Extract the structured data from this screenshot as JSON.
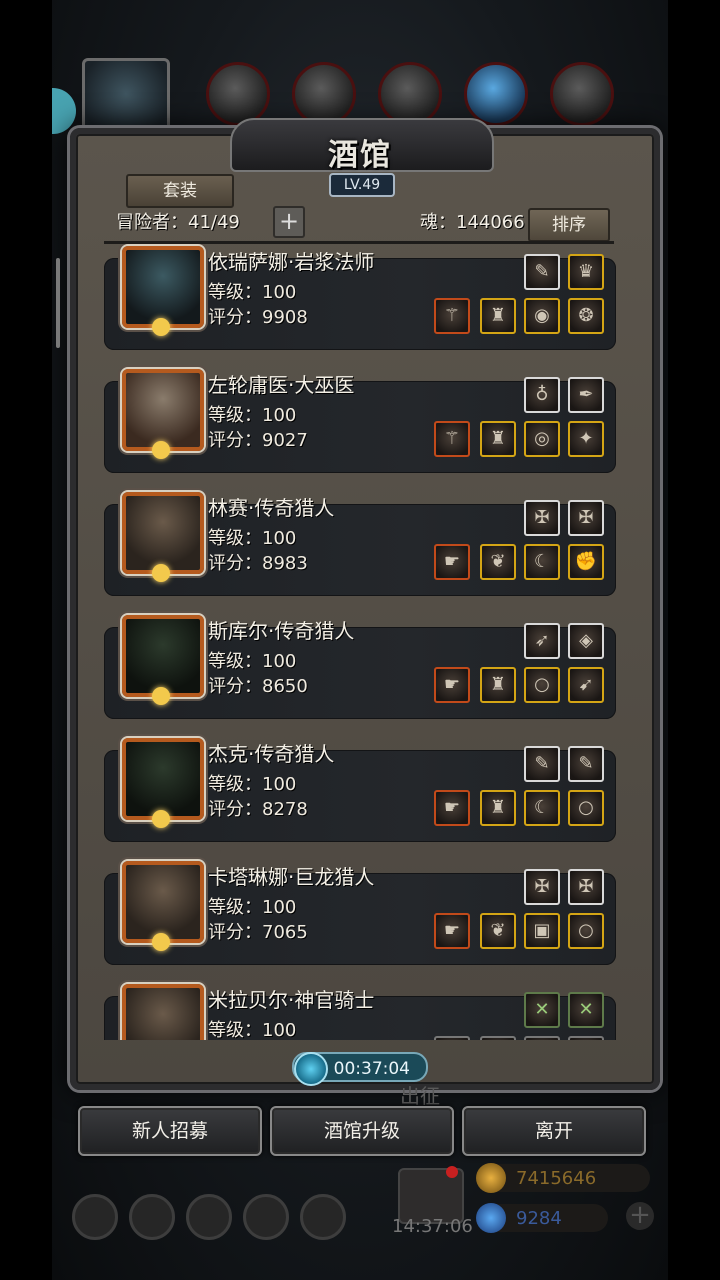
{
  "panel": {
    "title": "酒馆",
    "level_badge": "LV.49",
    "set_tab": "套装",
    "adventurers": "冒险者：41/49",
    "soul": "魂：144066",
    "sort_button": "排序",
    "plus_symbol": "+"
  },
  "heroes": [
    {
      "name": "依瑞萨娜·岩浆法师",
      "level": "等级：100",
      "score": "评分：9908",
      "portrait": "teal",
      "slots_top": [
        {
          "frame": "white",
          "icon": "feather-icon",
          "glyph": "✎"
        },
        {
          "frame": "gold",
          "icon": "trophy-icon",
          "glyph": "♛"
        }
      ],
      "slots_bottom": [
        {
          "frame": "red",
          "icon": "staff-icon",
          "glyph": "⚚"
        },
        {
          "frame": "gold",
          "icon": "robe-icon",
          "glyph": "♜"
        },
        {
          "frame": "gold",
          "icon": "orb-icon",
          "glyph": "◉"
        },
        {
          "frame": "gold",
          "icon": "rune-icon",
          "glyph": "❂"
        }
      ]
    },
    {
      "name": "左轮庸医·大巫医",
      "level": "等级：100",
      "score": "评分：9027",
      "portrait": "elder",
      "slots_top": [
        {
          "frame": "white",
          "icon": "amulet-icon",
          "glyph": "♁"
        },
        {
          "frame": "white",
          "icon": "dagger-icon",
          "glyph": "✒"
        }
      ],
      "slots_bottom": [
        {
          "frame": "red",
          "icon": "scepter-icon",
          "glyph": "⚚"
        },
        {
          "frame": "gold",
          "icon": "cloak-icon",
          "glyph": "♜"
        },
        {
          "frame": "gold",
          "icon": "bracer-icon",
          "glyph": "◎"
        },
        {
          "frame": "gold",
          "icon": "spark-icon",
          "glyph": "✦"
        }
      ]
    },
    {
      "name": "林赛·传奇猎人",
      "level": "等级：100",
      "score": "评分：8983",
      "portrait": "normal",
      "slots_top": [
        {
          "frame": "white",
          "icon": "emblem-icon",
          "glyph": "✠"
        },
        {
          "frame": "white",
          "icon": "emblem-icon",
          "glyph": "✠"
        }
      ],
      "slots_bottom": [
        {
          "frame": "red",
          "icon": "pistol-icon",
          "glyph": "☛"
        },
        {
          "frame": "gold",
          "icon": "wings-icon",
          "glyph": "❦"
        },
        {
          "frame": "gold",
          "icon": "horn-icon",
          "glyph": "☾"
        },
        {
          "frame": "gold",
          "icon": "gauntlet-icon",
          "glyph": "✊"
        }
      ]
    },
    {
      "name": "斯库尔·传奇猎人",
      "level": "等级：100",
      "score": "评分：8650",
      "portrait": "dark",
      "slots_top": [
        {
          "frame": "white",
          "icon": "crossbow-icon",
          "glyph": "➶"
        },
        {
          "frame": "white",
          "icon": "bracelet-icon",
          "glyph": "◈"
        }
      ],
      "slots_bottom": [
        {
          "frame": "red",
          "icon": "pistol-icon",
          "glyph": "☛"
        },
        {
          "frame": "gold",
          "icon": "armor-icon",
          "glyph": "♜"
        },
        {
          "frame": "gold",
          "icon": "ring-icon",
          "glyph": "○"
        },
        {
          "frame": "gold",
          "icon": "quiver-icon",
          "glyph": "➹"
        }
      ]
    },
    {
      "name": "杰克·传奇猎人",
      "level": "等级：100",
      "score": "评分：8278",
      "portrait": "dark",
      "slots_top": [
        {
          "frame": "white",
          "icon": "feather-icon",
          "glyph": "✎"
        },
        {
          "frame": "white",
          "icon": "feather-icon",
          "glyph": "✎"
        }
      ],
      "slots_bottom": [
        {
          "frame": "red",
          "icon": "pistol-icon",
          "glyph": "☛"
        },
        {
          "frame": "gold",
          "icon": "vest-icon",
          "glyph": "♜"
        },
        {
          "frame": "gold",
          "icon": "horn-icon",
          "glyph": "☾"
        },
        {
          "frame": "gold",
          "icon": "ring-icon",
          "glyph": "○"
        }
      ]
    },
    {
      "name": "卡塔琳娜·巨龙猎人",
      "level": "等级：100",
      "score": "评分：7065",
      "portrait": "normal",
      "slots_top": [
        {
          "frame": "white",
          "icon": "emblem-icon",
          "glyph": "✠"
        },
        {
          "frame": "white",
          "icon": "emblem-icon",
          "glyph": "✠"
        }
      ],
      "slots_bottom": [
        {
          "frame": "red",
          "icon": "pistol-icon",
          "glyph": "☛"
        },
        {
          "frame": "gold",
          "icon": "dragon-armor-icon",
          "glyph": "❦"
        },
        {
          "frame": "gold",
          "icon": "scroll-icon",
          "glyph": "▣"
        },
        {
          "frame": "gold",
          "icon": "ring-icon",
          "glyph": "○"
        }
      ]
    },
    {
      "name": "米拉贝尔·神官骑士",
      "level": "等级：100",
      "score": "",
      "portrait": "normal",
      "slots_top": [
        {
          "frame": "green",
          "icon": "cross-emblem-icon",
          "glyph": "✕"
        },
        {
          "frame": "green",
          "icon": "cross-emblem-icon",
          "glyph": "✕"
        }
      ],
      "slots_bottom": [
        {
          "frame": "gray",
          "icon": "item-icon",
          "glyph": ""
        },
        {
          "frame": "gray",
          "icon": "item-icon",
          "glyph": ""
        },
        {
          "frame": "gray",
          "icon": "item-icon",
          "glyph": ""
        },
        {
          "frame": "gray",
          "icon": "item-icon",
          "glyph": ""
        }
      ]
    }
  ],
  "timer": "00:37:04",
  "faded_label": "出征",
  "buttons": {
    "recruit": "新人招募",
    "upgrade": "酒馆升级",
    "leave": "离开"
  },
  "hud": {
    "clock": "14:37:06",
    "gold": "7415646",
    "gems": "9284",
    "plus": "+"
  },
  "colors": {
    "frame_white": "#d9d9d9",
    "frame_gold": "#d4a515",
    "frame_red": "#c24a1a",
    "gold_text": "#8a6a2a",
    "gem_text": "#3a5a9a"
  }
}
